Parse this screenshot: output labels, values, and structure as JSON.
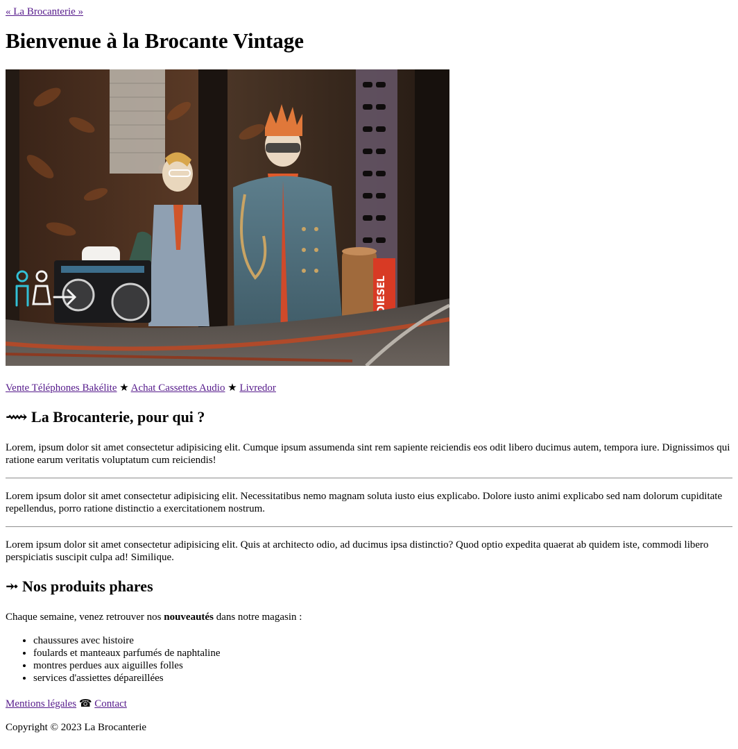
{
  "header": {
    "breadcrumb": "« La Brocanterie »",
    "title": "Bienvenue à la Brocante Vintage"
  },
  "hero": {
    "image_alt": "Vitrine de brocante avec mannequins vintage",
    "sign_text": "DIESEL"
  },
  "nav": {
    "links": [
      "Vente Téléphones Bakélite",
      "Achat Cassettes Audio",
      "Livredor"
    ],
    "separator": "★"
  },
  "section_for_whom": {
    "icon": "⟿",
    "title": "La Brocanterie, pour qui ?",
    "paragraphs": [
      "Lorem, ipsum dolor sit amet consectetur adipisicing elit. Cumque ipsum assumenda sint rem sapiente reiciendis eos odit libero ducimus autem, tempora iure. Dignissimos qui ratione earum veritatis voluptatum cum reiciendis!",
      "Lorem ipsum dolor sit amet consectetur adipisicing elit. Necessitatibus nemo magnam soluta iusto eius explicabo. Dolore iusto animi explicabo sed nam dolorum cupiditate repellendus, porro ratione distinctio a exercitationem nostrum.",
      "Lorem ipsum dolor sit amet consectetur adipisicing elit. Quis at architecto odio, ad ducimus ipsa distinctio? Quod optio expedita quaerat ab quidem iste, commodi libero perspiciatis suscipit culpa ad! Similique."
    ]
  },
  "section_products": {
    "icon": "⤞",
    "title": "Nos produits phares",
    "intro_before": "Chaque semaine, venez retrouver nos ",
    "intro_bold": "nouveautés",
    "intro_after": " dans notre magasin :",
    "items": [
      "chaussures avec histoire",
      "foulards et manteaux parfumés de naphtaline",
      "montres perdues aux aiguilles folles",
      "services d'assiettes dépareillées"
    ]
  },
  "footer": {
    "links": [
      "Mentions légales",
      "Contact"
    ],
    "separator": "☎",
    "copyright": "Copyright © 2023 La Brocanterie"
  }
}
